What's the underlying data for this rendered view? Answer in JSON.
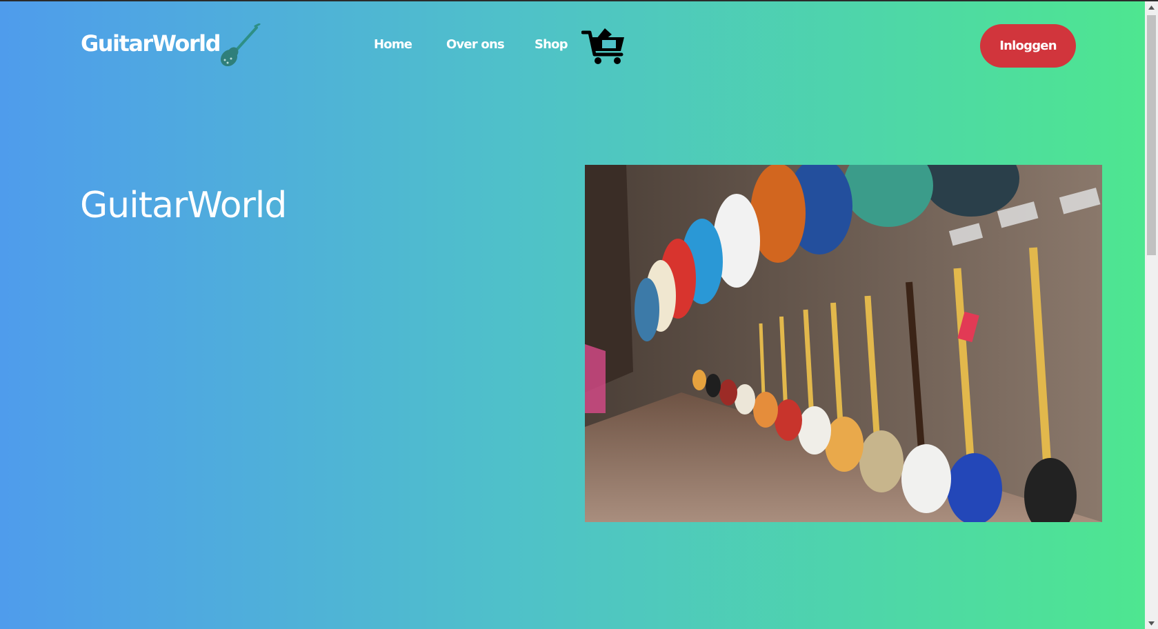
{
  "header": {
    "logo_text": "GuitarWorld",
    "nav": [
      "Home",
      "Over ons",
      "Shop"
    ],
    "login_label": "Inloggen"
  },
  "hero": {
    "title": "GuitarWorld"
  },
  "icons": {
    "logo": "electric-guitar-icon",
    "cart": "shopping-cart-icon"
  },
  "colors": {
    "gradient_start": "#4f9cec",
    "gradient_end": "#4ee690",
    "login_button": "#d1353c"
  }
}
